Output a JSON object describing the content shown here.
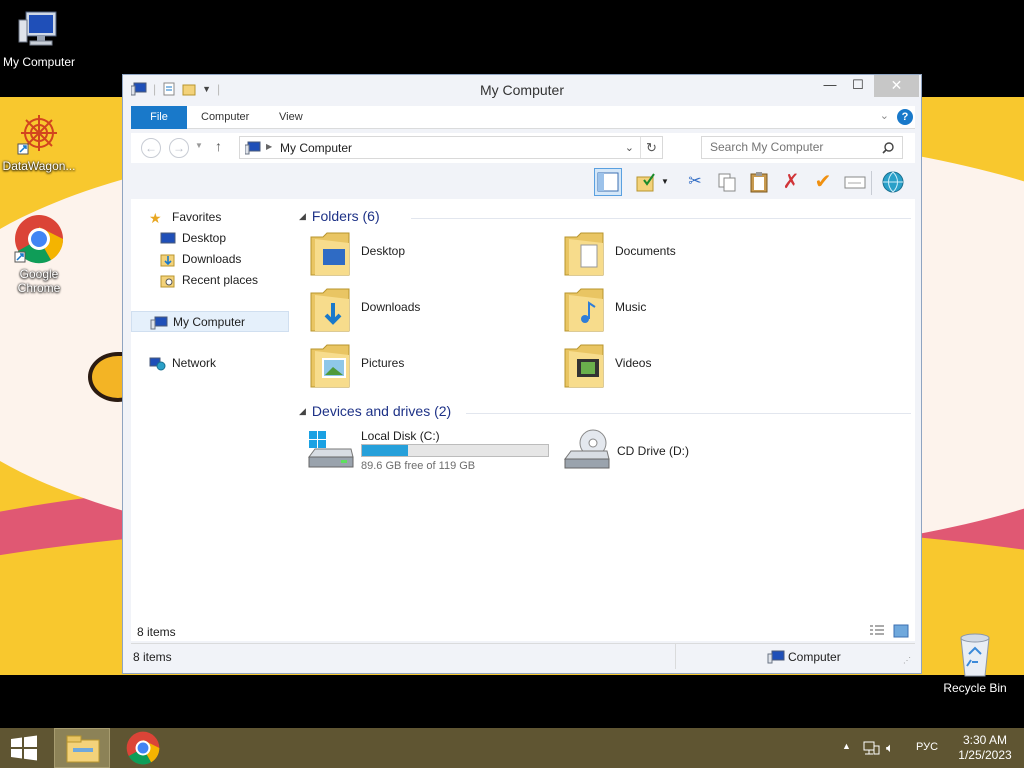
{
  "desktop": {
    "icons": [
      {
        "label": "My Computer"
      },
      {
        "label": "DataWagon..."
      },
      {
        "label": "Google Chrome"
      },
      {
        "label": "Recycle Bin"
      }
    ]
  },
  "window": {
    "title": "My Computer",
    "controls": {
      "minimize": "—",
      "maximize": "☐",
      "close": "✕"
    },
    "ribbon_tabs": [
      "File",
      "Computer",
      "View"
    ],
    "address": {
      "location": "My Computer"
    },
    "search": {
      "placeholder": "Search My Computer"
    },
    "nav": {
      "favorites": "Favorites",
      "favorites_items": [
        "Desktop",
        "Downloads",
        "Recent places"
      ],
      "computer": "My Computer",
      "network": "Network"
    },
    "groups": {
      "folders": {
        "title": "Folders (6)",
        "items": [
          {
            "name": "Desktop",
            "icon": "desktop-folder-icon"
          },
          {
            "name": "Documents",
            "icon": "documents-folder-icon"
          },
          {
            "name": "Downloads",
            "icon": "downloads-folder-icon"
          },
          {
            "name": "Music",
            "icon": "music-folder-icon"
          },
          {
            "name": "Pictures",
            "icon": "pictures-folder-icon"
          },
          {
            "name": "Videos",
            "icon": "videos-folder-icon"
          }
        ]
      },
      "drives": {
        "title": "Devices and drives (2)",
        "local_disk": {
          "name": "Local Disk (C:)",
          "free_text": "89.6 GB free of 119 GB",
          "used_fraction": 0.247
        },
        "cd_drive": {
          "name": "CD Drive (D:)"
        }
      }
    },
    "status": {
      "items_count": "8 items",
      "details_items": "8 items",
      "details_location": "Computer"
    }
  },
  "taskbar": {
    "language": "РУС",
    "time": "3:30 AM",
    "date": "1/25/2023"
  },
  "colors": {
    "accent": "#1979ca",
    "drive_fill": "#26a0da",
    "taskbar": "#5f5532"
  }
}
